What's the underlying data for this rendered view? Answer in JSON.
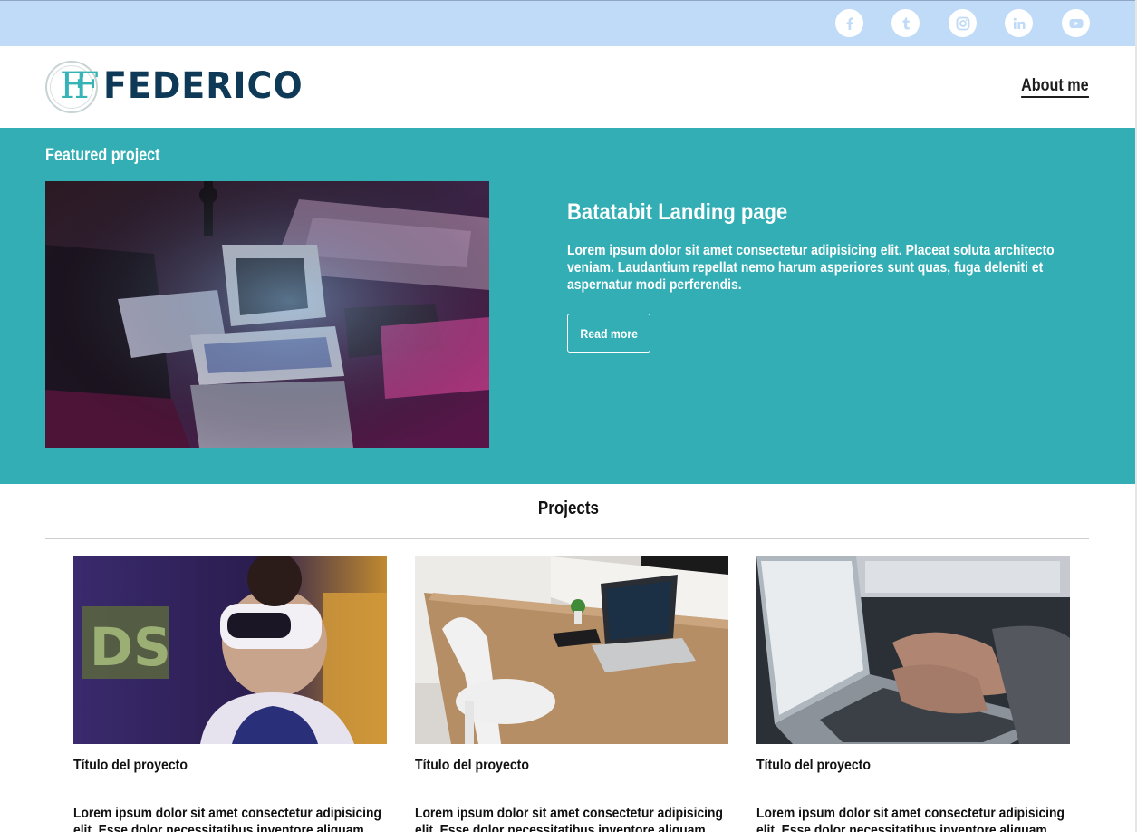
{
  "social": {
    "links": [
      "facebook-icon",
      "tumblr-icon",
      "instagram-icon",
      "linkedin-icon",
      "youtube-icon"
    ]
  },
  "header": {
    "logo_monogram": "FF",
    "logo_text": "FEDERICO",
    "nav_about": "About me"
  },
  "featured": {
    "label": "Featured project",
    "title": "Batatabit Landing page",
    "description": "Lorem ipsum dolor sit amet consectetur adipisicing elit. Placeat soluta architecto veniam. Laudantium repellat nemo harum asperiores sunt quas, fuga deleniti et aspernatur modi perferendis.",
    "button": "Read more"
  },
  "projects": {
    "title": "Projects",
    "cards": [
      {
        "title": "Título del proyecto",
        "description": "Lorem ipsum dolor sit amet consectetur adipisicing elit. Esse dolor necessitatibus inventore aliquam, veniam"
      },
      {
        "title": "Título del proyecto",
        "description": "Lorem ipsum dolor sit amet consectetur adipisicing elit. Esse dolor necessitatibus inventore aliquam, veniam"
      },
      {
        "title": "Título del proyecto",
        "description": "Lorem ipsum dolor sit amet consectetur adipisicing elit. Esse dolor necessitatibus inventore aliquam, veniam"
      }
    ]
  },
  "colors": {
    "topbar": "#c0dbf7",
    "featured_bg": "#33aeb5",
    "logo_dark": "#0e3a57",
    "logo_accent": "#36b3b6"
  }
}
